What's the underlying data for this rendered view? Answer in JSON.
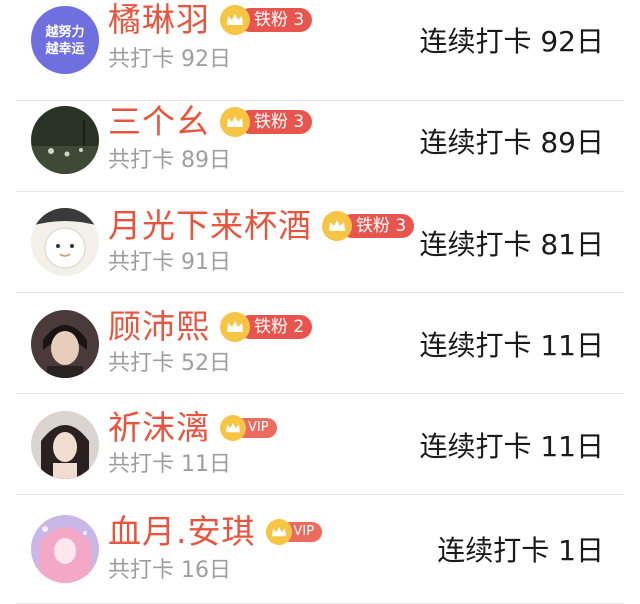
{
  "rows": [
    {
      "name": "橘琳羽",
      "badge": {
        "type": "fan",
        "label": "铁粉",
        "level": "3"
      },
      "total": "共打卡 92日",
      "streak": "连续打卡 92日",
      "avatar": "avatar-text-image",
      "avatar_text": [
        "越努力",
        "越幸运"
      ]
    },
    {
      "name": "三个幺",
      "badge": {
        "type": "fan",
        "label": "铁粉",
        "level": "3"
      },
      "total": "共打卡 89日",
      "streak": "连续打卡 89日",
      "avatar": "avatar-dark-landscape"
    },
    {
      "name": "月光下来杯酒",
      "badge": {
        "type": "fan",
        "label": "铁粉",
        "level": "3"
      },
      "total": "共打卡 91日",
      "streak": "连续打卡 81日",
      "avatar": "avatar-cartoon"
    },
    {
      "name": "顾沛熙",
      "badge": {
        "type": "fan",
        "label": "铁粉",
        "level": "2"
      },
      "total": "共打卡 52日",
      "streak": "连续打卡 11日",
      "avatar": "avatar-portrait"
    },
    {
      "name": "祈沫漓",
      "badge": {
        "type": "vip",
        "label": "VIP"
      },
      "total": "共打卡 11日",
      "streak": "连续打卡 11日",
      "avatar": "avatar-portrait"
    },
    {
      "name": "血月.安琪",
      "badge": {
        "type": "vip",
        "label": "VIP"
      },
      "total": "共打卡 16日",
      "streak": "连续打卡 1日",
      "avatar": "avatar-anime"
    }
  ],
  "colors": {
    "name": "#e8553e",
    "badge": "#e8554e",
    "crown": "#f6c544",
    "muted": "#9e9e9e"
  }
}
